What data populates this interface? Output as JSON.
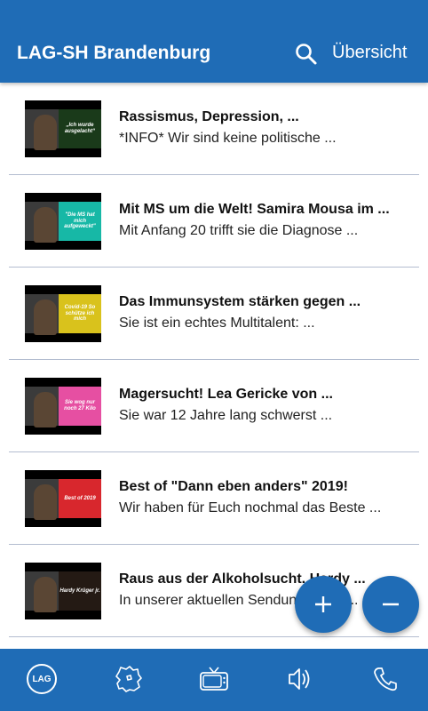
{
  "appbar": {
    "title": "LAG-SH Brandenburg",
    "overview_label": "Übersicht",
    "search_icon": "search-icon"
  },
  "videos": [
    {
      "title": "Rassismus, Depression, ...",
      "description": "*INFO* Wir sind keine politische ...",
      "thumb_text": "„Ich wurde ausgelacht“",
      "thumb_color": "#1a3a1a",
      "thumb_text_color": "#ffffff"
    },
    {
      "title": "Mit MS um die Welt! Samira Mousa im ...",
      "description": "Mit Anfang 20 trifft sie die Diagnose ...",
      "thumb_text": "\"Die MS hat mich aufgeweckt\"",
      "thumb_color": "#17b8a6",
      "thumb_text_color": "#ffffff"
    },
    {
      "title": "Das Immunsystem stärken gegen ...",
      "description": "Sie ist ein echtes Multitalent: ...",
      "thumb_text": "Covid-19 So schütze ich mich",
      "thumb_color": "#d9c21c",
      "thumb_text_color": "#ffffff"
    },
    {
      "title": "Magersucht! Lea Gericke von ...",
      "description": "Sie war 12 Jahre lang schwerst ...",
      "thumb_text": "Sie wog nur noch 27 Kilo",
      "thumb_color": "#e64fa2",
      "thumb_text_color": "#ffffff"
    },
    {
      "title": "Best of \"Dann eben anders\" 2019!",
      "description": "Wir haben für Euch nochmal das Beste ...",
      "thumb_text": "Best of 2019",
      "thumb_color": "#d8272d",
      "thumb_text_color": "#ffffff"
    },
    {
      "title": "Raus aus der Alkoholsucht. Hardy ...",
      "description": "In unserer  aktuellen Sendung sprich...",
      "thumb_text": "Hardy Krüger jr.",
      "thumb_color": "#241a14",
      "thumb_text_color": "#ffffff"
    }
  ],
  "fab": {
    "plus": "+",
    "minus": "−"
  },
  "bottom_nav": {
    "items": [
      {
        "icon": "lag-logo-icon",
        "label": "LAG"
      },
      {
        "icon": "brandenburg-map-icon"
      },
      {
        "icon": "tv-icon"
      },
      {
        "icon": "speaker-icon"
      },
      {
        "icon": "phone-icon"
      }
    ]
  },
  "colors": {
    "primary": "#1f6cb6",
    "divider": "#b3bdd0"
  }
}
